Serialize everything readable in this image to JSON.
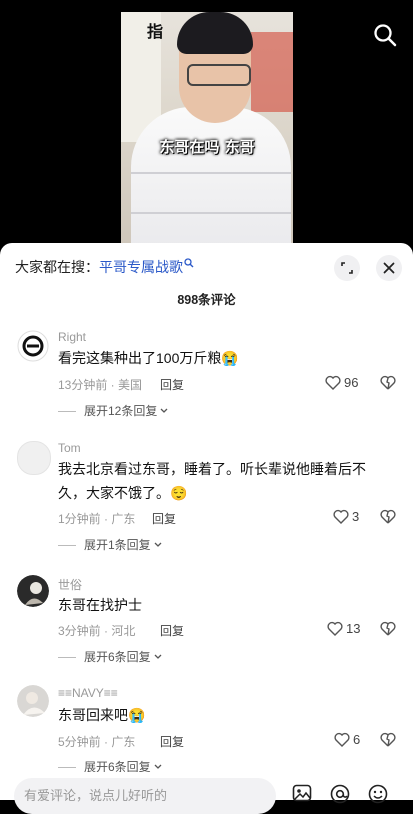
{
  "video": {
    "caption": "东哥在吗 东哥",
    "poster_text": "指"
  },
  "header": {
    "search_label": "大家都在搜：",
    "search_keyword": "平哥专属战歌",
    "comment_count": "898条评论"
  },
  "comments": [
    {
      "user": "Right",
      "text": "看完这集种出了100万斤粮😭",
      "time": "13分钟前 · 美国",
      "reply": "回复",
      "likes": "96",
      "expand": "展开12条回复"
    },
    {
      "user": "Tom",
      "text": "我去北京看过东哥，睡着了。听长辈说他睡着后不久，大家不饿了。😌",
      "time": "1分钟前 · 广东",
      "reply": "回复",
      "likes": "3",
      "expand": "展开1条回复"
    },
    {
      "user": "世俗",
      "text": "东哥在找护士",
      "time": "3分钟前 · 河北",
      "reply": "回复",
      "likes": "13",
      "expand": "展开6条回复"
    },
    {
      "user": "≡≡NAVY≡≡",
      "text": "东哥回来吧😭",
      "time": "5分钟前 · 广东",
      "reply": "回复",
      "likes": "6",
      "expand": "展开6条回复"
    }
  ],
  "input": {
    "placeholder": "有爱评论，说点儿好听的"
  },
  "icons": {
    "search": "search-icon",
    "expand": "expand-icon",
    "close": "close-icon",
    "like": "heart-icon",
    "dislike": "dislike-icon",
    "image": "image-icon",
    "mention": "at-icon",
    "emoji": "emoji-icon"
  }
}
